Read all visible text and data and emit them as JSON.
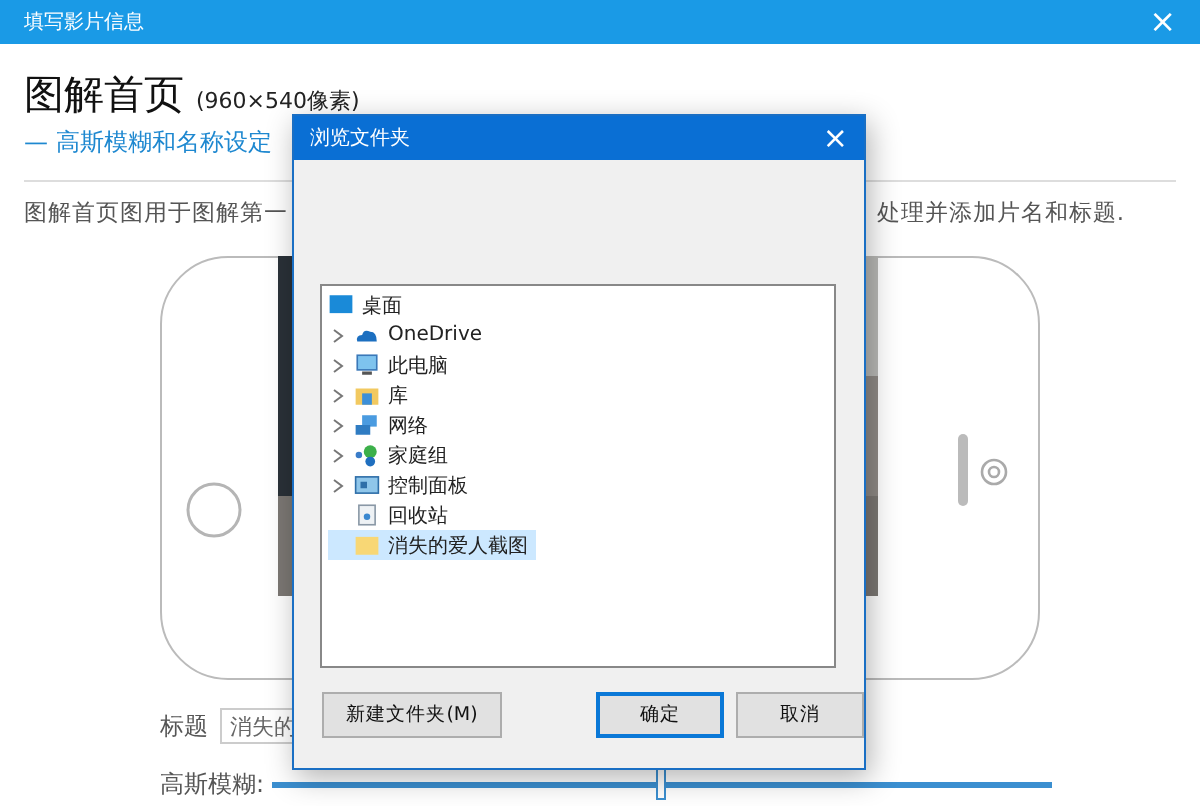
{
  "window": {
    "title": "填写影片信息",
    "close": "×"
  },
  "heading": {
    "title": "图解首页",
    "size": "(960×540像素)",
    "subtitle": "— 高斯模糊和名称设定"
  },
  "description": [
    "图解首页图用于图解第一",
    "处理并添加片名和标题."
  ],
  "form": {
    "title_label": "标题",
    "title_value": "消失的",
    "blur_label": "高斯模糊:",
    "blur": {
      "level": 0.5
    }
  },
  "dialog": {
    "title": "浏览文件夹",
    "close": "×",
    "tree": [
      {
        "label": "桌面",
        "kind": "desktop",
        "selected": false,
        "children": [
          {
            "label": "OneDrive",
            "kind": "cloud",
            "expandable": true,
            "selected": false
          },
          {
            "label": "此电脑",
            "kind": "computer",
            "expandable": true,
            "selected": false
          },
          {
            "label": "库",
            "kind": "library",
            "expandable": true,
            "selected": false
          },
          {
            "label": "网络",
            "kind": "network",
            "expandable": true,
            "selected": false
          },
          {
            "label": "家庭组",
            "kind": "homegroup",
            "expandable": true,
            "selected": false
          },
          {
            "label": "控制面板",
            "kind": "control",
            "expandable": true,
            "selected": false
          },
          {
            "label": "回收站",
            "kind": "bin",
            "expandable": false,
            "selected": false
          },
          {
            "label": "消失的爱人截图",
            "kind": "folder",
            "expandable": false,
            "selected": true
          }
        ]
      }
    ],
    "buttons": [
      {
        "label": "新建文件夹(M)",
        "kind": "left",
        "default": false
      },
      {
        "label": "确定",
        "kind": "right",
        "default": true
      },
      {
        "label": "取消",
        "kind": "right",
        "default": false
      }
    ]
  }
}
